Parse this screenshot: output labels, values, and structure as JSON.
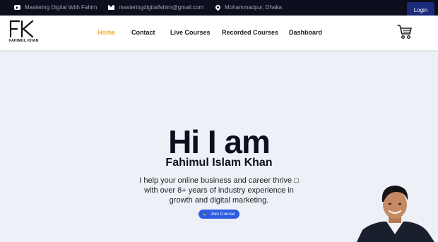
{
  "topbar": {
    "channel": "Mastering Digital With Fahim",
    "email": "masteringdigitalfahim@gmail.com",
    "location": "Mohammadpur, Dhaka",
    "login_label": "Login"
  },
  "brand": {
    "logo_mark": "FK",
    "logo_text": "FAHIMUL KHAN"
  },
  "nav": {
    "items": [
      {
        "label": "Home",
        "active": true
      },
      {
        "label": "Contact"
      },
      {
        "label": "Live Courses"
      },
      {
        "label": "Recorded Courses"
      },
      {
        "label": "Dashboard"
      }
    ]
  },
  "hero": {
    "title": "Hi I am",
    "name": "Fahimul Islam Khan",
    "description": "I help your online business and career thrive □ with over 8+ years of industry experience in growth and digital marketing.",
    "cta_label": "Join Course"
  },
  "colors": {
    "accent": "#e8b04a",
    "dark": "#0c0f1d",
    "button_blue": "#2d5be3",
    "login_blue": "#1b2a7a"
  }
}
